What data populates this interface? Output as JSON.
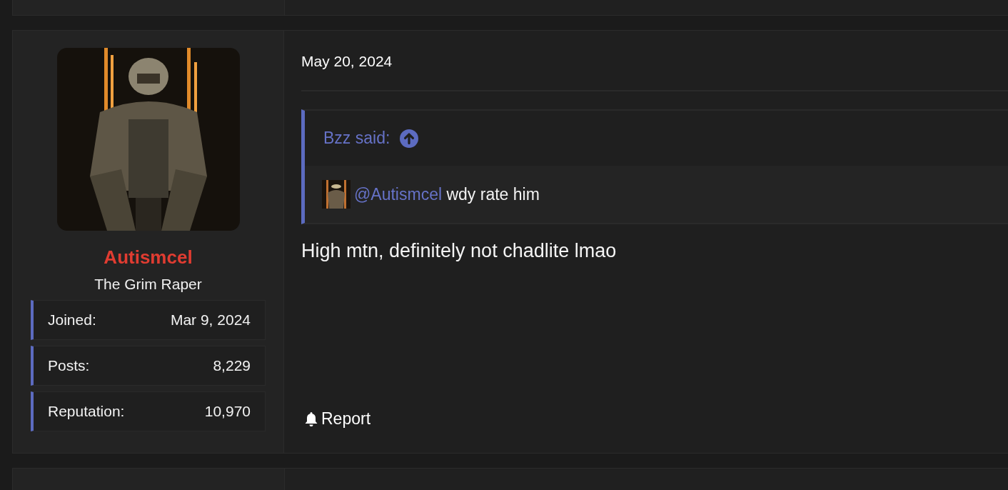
{
  "post": {
    "author": {
      "name": "Autismcel",
      "title": "The Grim Raper",
      "stats": [
        {
          "label": "Joined:",
          "value": "Mar 9, 2024"
        },
        {
          "label": "Posts:",
          "value": "8,229"
        },
        {
          "label": "Reputation:",
          "value": "10,970"
        }
      ]
    },
    "date": "May 20, 2024",
    "quote": {
      "header": "Bzz said:",
      "mention": "@Autismcel",
      "text": "wdy rate him"
    },
    "message": "High mtn, definitely not chadlite lmao",
    "actions": [
      {
        "label": "Report"
      }
    ]
  }
}
